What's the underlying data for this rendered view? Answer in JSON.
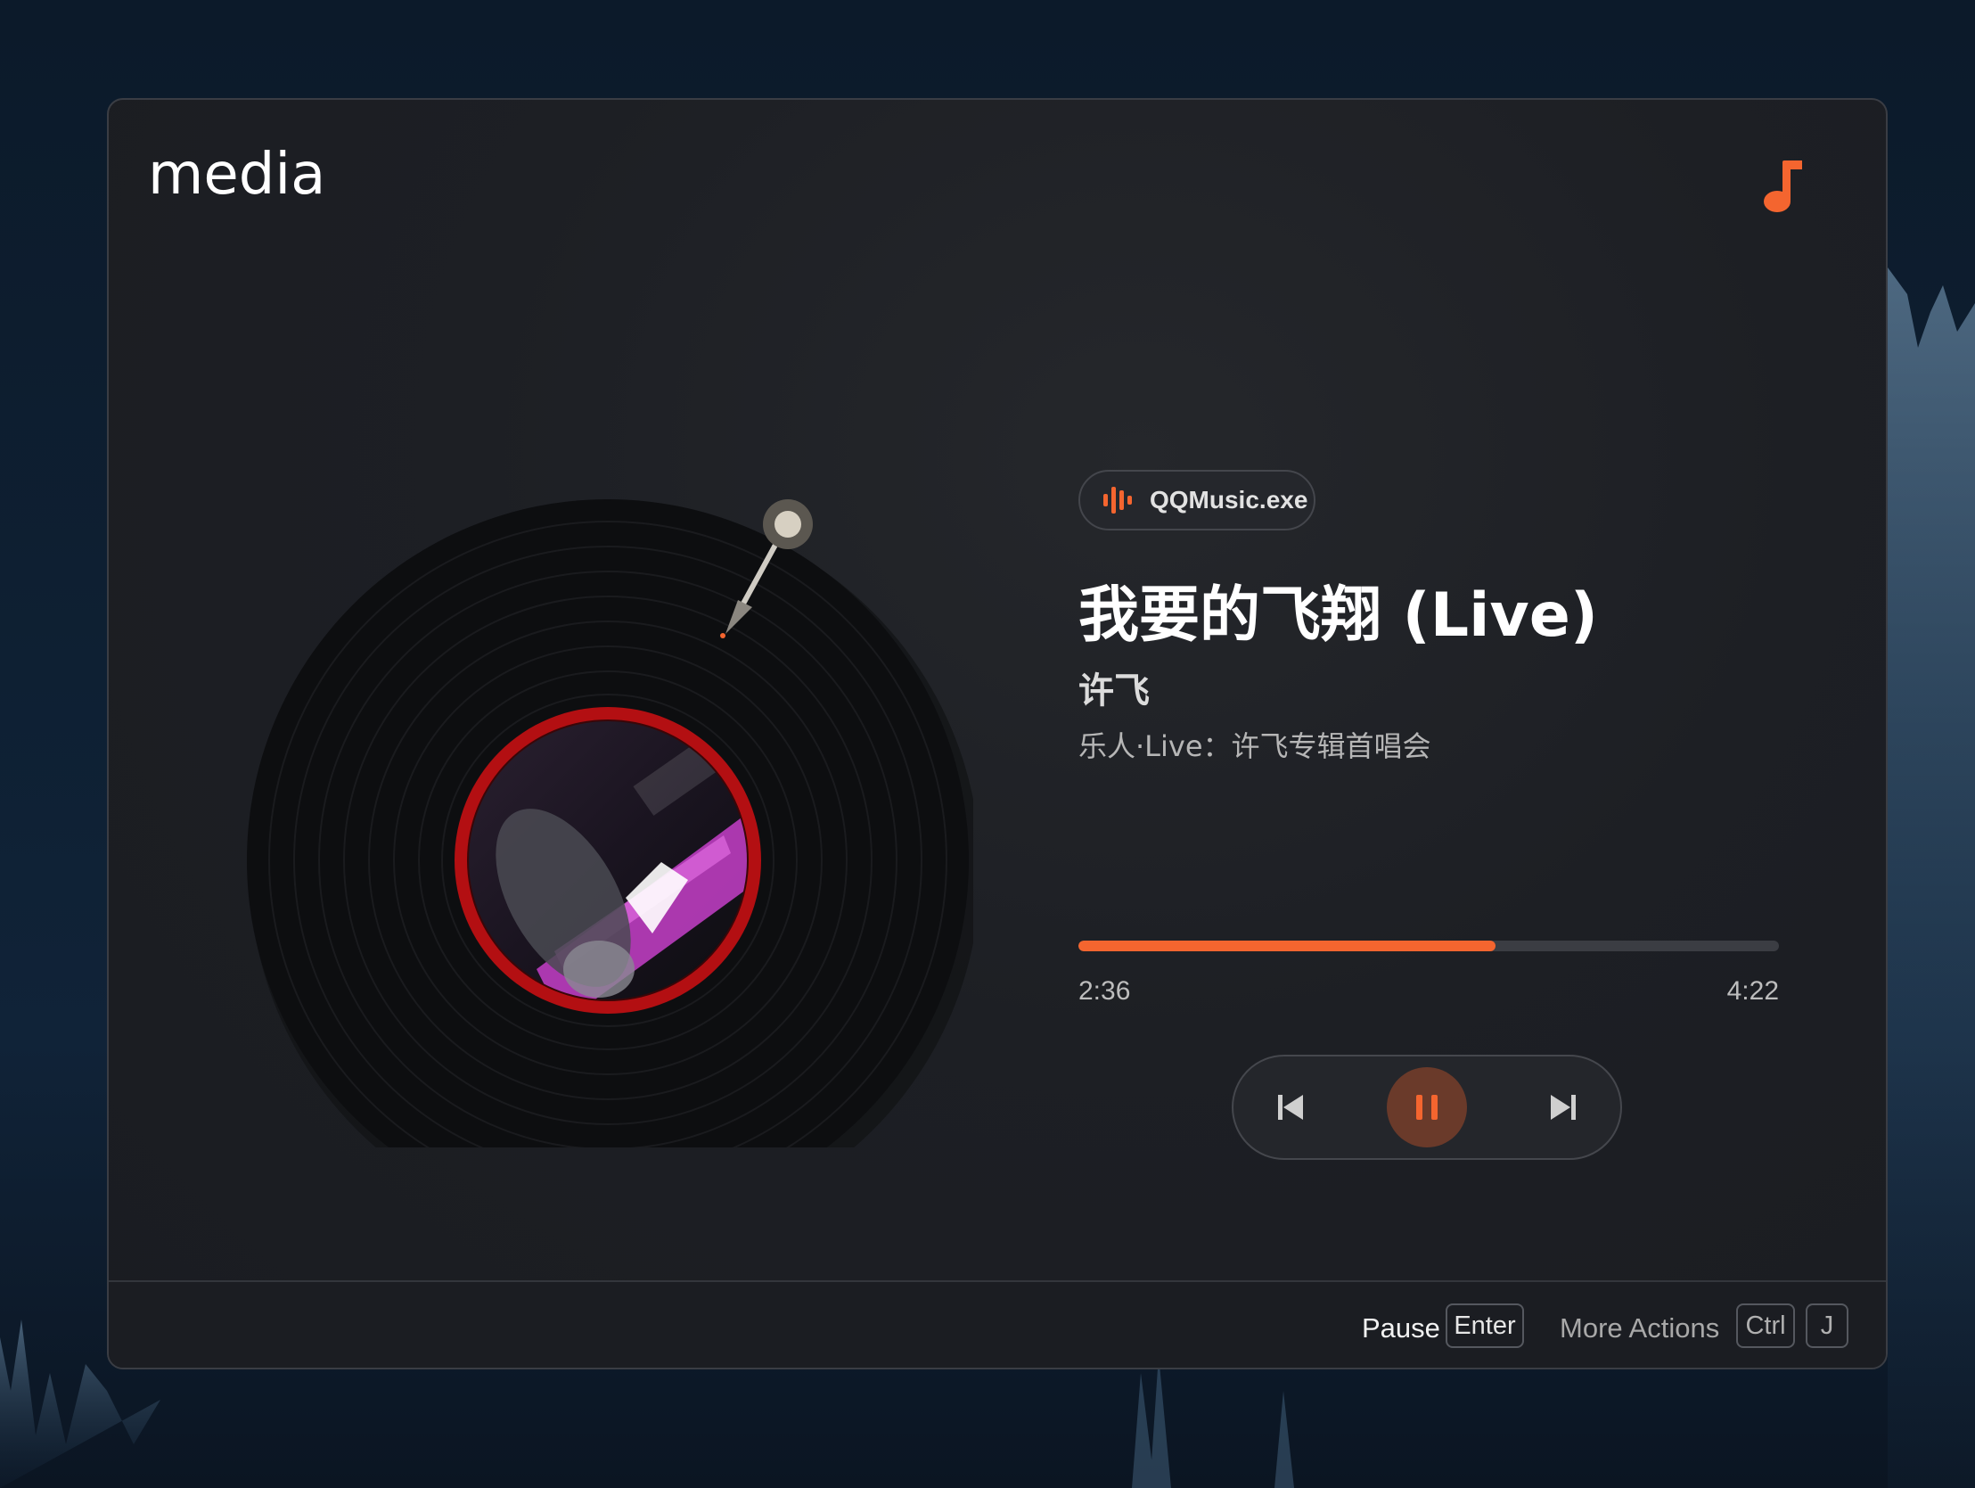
{
  "window": {
    "title": "media",
    "icon": "music-note-icon"
  },
  "player": {
    "source": {
      "label": "QQMusic.exe",
      "icon": "audio-bars-icon"
    },
    "song_title": "我要的飞翔 (Live)",
    "artist": "许飞",
    "album": "乐人·Live：许飞专辑首唱会",
    "elapsed": "2:36",
    "total": "4:22",
    "progress_fraction": 0.595,
    "controls": {
      "previous": "skip-previous-icon",
      "pause": "pause-icon",
      "next": "skip-next-icon"
    }
  },
  "footer": {
    "primary_action": "Pause",
    "primary_key": "Enter",
    "secondary_action": "More Actions",
    "secondary_keys": [
      "Ctrl",
      "J"
    ]
  },
  "colors": {
    "accent": "#f4652f",
    "window_bg": "#1d1f24",
    "record_label_ring": "#b30f12"
  }
}
